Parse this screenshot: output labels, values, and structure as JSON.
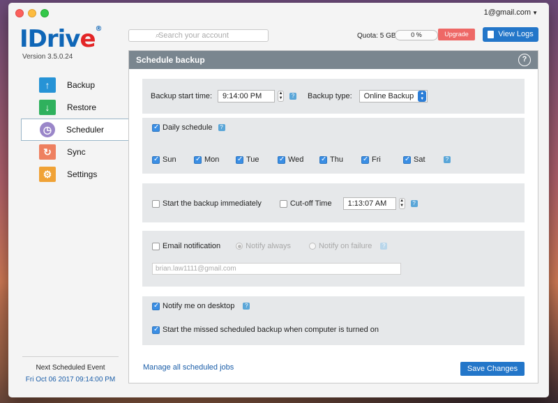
{
  "account": {
    "email": "1@gmail.com"
  },
  "brand": {
    "logo_main": "IDriv",
    "logo_e": "e",
    "logo_reg": "®",
    "version": "Version 3.5.0.24"
  },
  "nav": [
    {
      "label": "Backup",
      "icon": "arrow-up-icon"
    },
    {
      "label": "Restore",
      "icon": "arrow-down-icon"
    },
    {
      "label": "Scheduler",
      "icon": "clock-icon"
    },
    {
      "label": "Sync",
      "icon": "sync-icon"
    },
    {
      "label": "Settings",
      "icon": "gear-icon"
    }
  ],
  "next_event": {
    "label": "Next Scheduled Event",
    "value": "Fri Oct 06 2017 09:14:00 PM"
  },
  "topbar": {
    "search_placeholder": "Search your account",
    "quota_label": "Quota: 5 GB",
    "quota_percent": "0 %",
    "upgrade": "Upgrade",
    "view_logs": "View Logs"
  },
  "panel": {
    "title": "Schedule backup",
    "help": "?",
    "start_time_label": "Backup start time:",
    "start_time_value": "9:14:00 PM",
    "type_label": "Backup type:",
    "type_value": "Online Backup",
    "daily_label": "Daily schedule",
    "days": [
      {
        "label": "Sun",
        "checked": true
      },
      {
        "label": "Mon",
        "checked": true
      },
      {
        "label": "Tue",
        "checked": true
      },
      {
        "label": "Wed",
        "checked": true
      },
      {
        "label": "Thu",
        "checked": true
      },
      {
        "label": "Fri",
        "checked": true
      },
      {
        "label": "Sat",
        "checked": true
      }
    ],
    "start_immediately": "Start the backup immediately",
    "cutoff_label": "Cut-off Time",
    "cutoff_value": "1:13:07 AM",
    "email_label": "Email notification",
    "notify_always": "Notify always",
    "notify_failure": "Notify on failure",
    "email_value": "brian.law1111@gmail.com",
    "notify_desktop": "Notify me on desktop",
    "missed_backup": "Start the missed scheduled backup when computer is turned on",
    "manage_link": "Manage all scheduled jobs",
    "save": "Save Changes"
  }
}
